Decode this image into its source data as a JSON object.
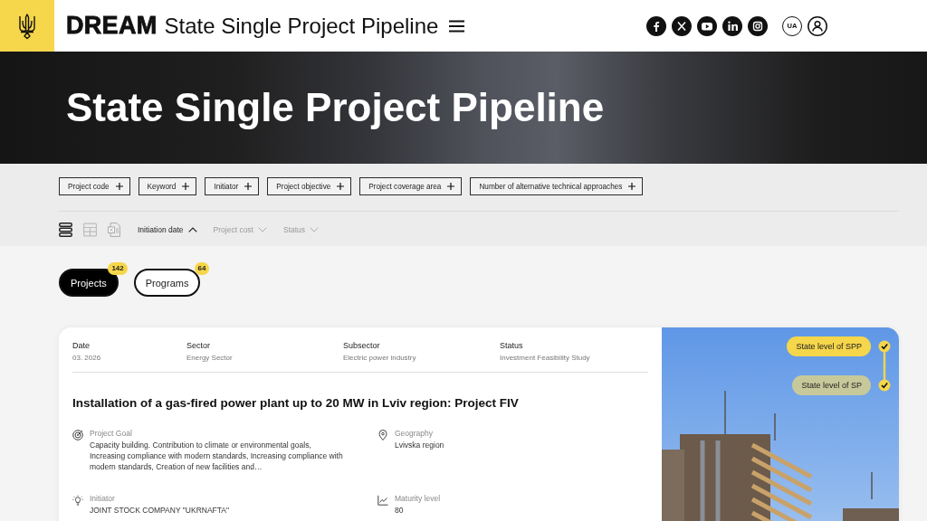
{
  "header": {
    "brand": "DREAM",
    "title": "State Single Project Pipeline",
    "language": "UA"
  },
  "hero": {
    "title": "State Single Project Pipeline"
  },
  "filters": [
    "Project code",
    "Keyword",
    "Initiator",
    "Project objective",
    "Project coverage area",
    "Number of alternative technical approaches"
  ],
  "views": [
    {
      "kind": "list",
      "selected": true
    },
    {
      "kind": "table",
      "selected": false
    }
  ],
  "sort_options": [
    {
      "label": "Initiation date",
      "selected": true
    },
    {
      "label": "Project cost",
      "selected": false
    },
    {
      "label": "Status",
      "selected": false
    }
  ],
  "tabs": [
    {
      "label": "Projects",
      "count": "142",
      "selected": true
    },
    {
      "label": "Programs",
      "count": "64",
      "selected": false
    }
  ],
  "project_card": {
    "meta": [
      {
        "label": "Date",
        "value": "03. 2026"
      },
      {
        "label": "Sector",
        "value": "Energy Sector"
      },
      {
        "label": "Subsector",
        "value": "Electric power industry"
      },
      {
        "label": "Status",
        "value": "Investment Feasibility Study"
      }
    ],
    "title": "Installation of a gas-fired power plant up to 20 MW in Lviv region: Project FIV",
    "details": [
      {
        "kind": "goal",
        "label": "Project Goal",
        "value": "Capacity building. Contribution to climate or environmental goals, Increasing compliance with modern standards, Increasing compliance with modern standards, Creation of new facilities and…"
      },
      {
        "kind": "geography",
        "label": "Geography",
        "value": "Lvivska region"
      },
      {
        "kind": "initiator",
        "label": "Initiator",
        "value": "JOINT STOCK COMPANY \"UKRNAFTA\""
      },
      {
        "kind": "maturity",
        "label": "Maturity level",
        "value": "80"
      }
    ],
    "levels": [
      {
        "label": "State level of SPP",
        "active": true,
        "checked": true
      },
      {
        "label": "State level of SP",
        "active": false,
        "checked": true
      }
    ]
  }
}
